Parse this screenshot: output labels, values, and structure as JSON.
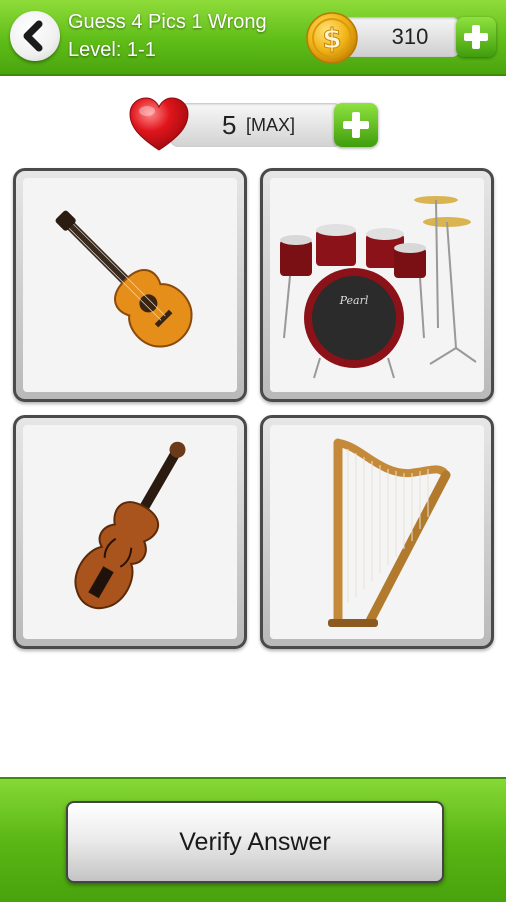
{
  "header": {
    "title": "Guess 4 Pics 1 Wrong",
    "level": "Level: 1-1",
    "coins": "310",
    "back_icon": "chevron-left-icon",
    "coin_icon": "dollar-coin-icon",
    "add_coins_icon": "plus-icon"
  },
  "lives": {
    "count": "5",
    "max_label": "[MAX]",
    "heart_icon": "heart-icon",
    "add_lives_icon": "plus-icon"
  },
  "pictures": [
    {
      "subject": "acoustic-guitar"
    },
    {
      "subject": "drum-kit"
    },
    {
      "subject": "violin"
    },
    {
      "subject": "harp"
    }
  ],
  "footer": {
    "verify_label": "Verify Answer"
  },
  "colors": {
    "header_green": "#5fbd18",
    "footer_green": "#5ab715",
    "plus_green": "#3f9d0c",
    "heart_red": "#e0151c",
    "coin_gold": "#f2b417"
  }
}
